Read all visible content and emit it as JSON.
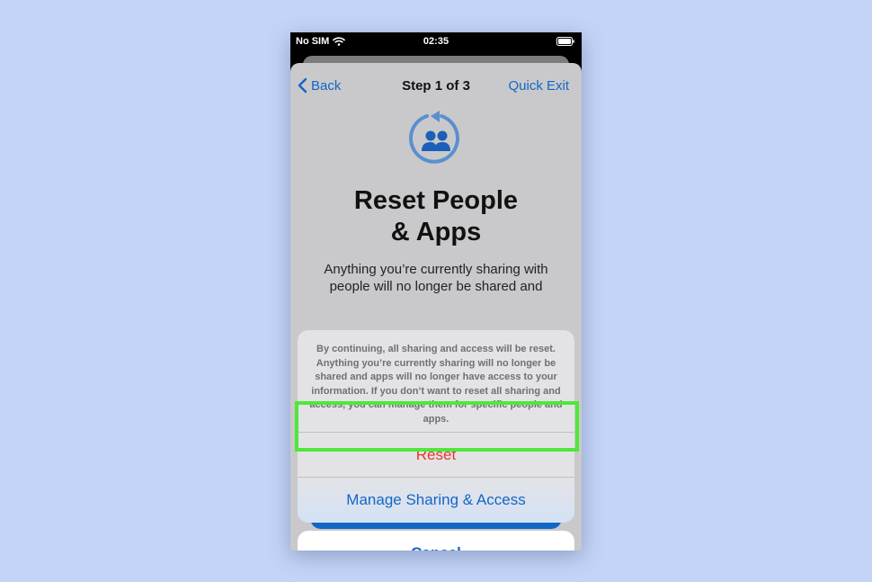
{
  "status_bar": {
    "carrier": "No SIM",
    "time": "02:35"
  },
  "nav": {
    "back_label": "Back",
    "title": "Step 1 of 3",
    "exit_label": "Quick Exit"
  },
  "hero": {
    "icon": "reset-people-icon",
    "title_line1": "Reset People",
    "title_line2": "& Apps",
    "description": "Anything you’re currently sharing with people will no longer be shared and"
  },
  "action_sheet": {
    "message": "By continuing, all sharing and access will be reset. Anything you’re currently sharing will no longer be shared and apps will no longer have access to your information. If you don’t want to reset all sharing and access, you can manage them for specific people and apps.",
    "reset_label": "Reset",
    "manage_label": "Manage Sharing & Access",
    "cancel_label": "Cancel"
  },
  "colors": {
    "accent": "#1466c6",
    "destructive": "#e8372f",
    "highlight": "#4ee83a",
    "background": "#c4d4f7"
  }
}
